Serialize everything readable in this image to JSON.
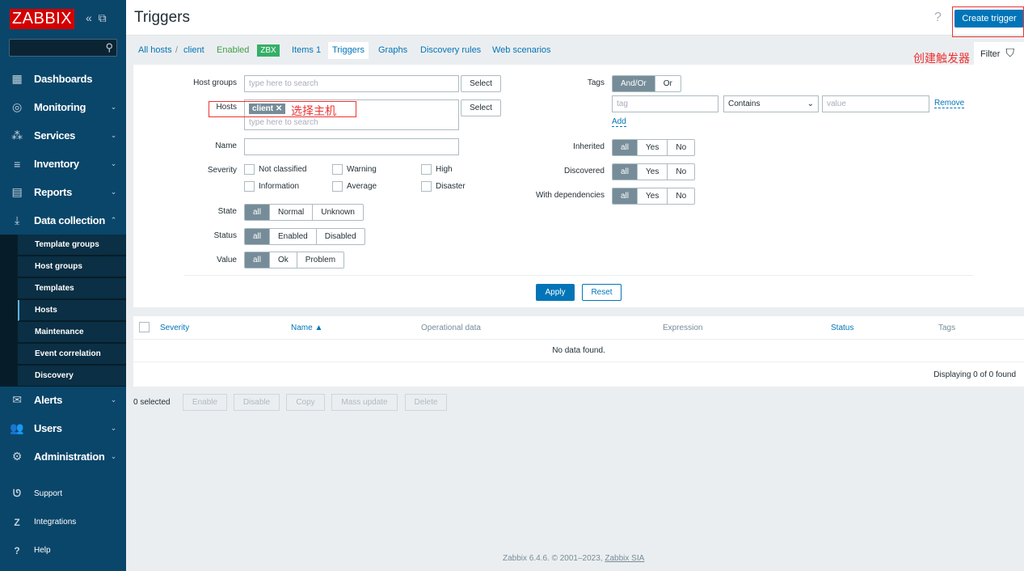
{
  "sidebar": {
    "logo": "ZABBIX",
    "search_icon": "search-icon",
    "menu": [
      {
        "label": "Dashboards",
        "icon": "▦"
      },
      {
        "label": "Monitoring",
        "icon": "◎"
      },
      {
        "label": "Services",
        "icon": "⁂"
      },
      {
        "label": "Inventory",
        "icon": "≡"
      },
      {
        "label": "Reports",
        "icon": "▤"
      },
      {
        "label": "Data collection",
        "icon": "⤓"
      }
    ],
    "submenu": [
      "Template groups",
      "Host groups",
      "Templates",
      "Hosts",
      "Maintenance",
      "Event correlation",
      "Discovery"
    ],
    "menu2": [
      {
        "label": "Alerts",
        "icon": "✉"
      },
      {
        "label": "Users",
        "icon": "👥"
      },
      {
        "label": "Administration",
        "icon": "⚙"
      }
    ],
    "bottom": [
      {
        "label": "Support",
        "icon": "ᘎ"
      },
      {
        "label": "Integrations",
        "icon": "Z"
      },
      {
        "label": "Help",
        "icon": "?"
      }
    ]
  },
  "header": {
    "title": "Triggers",
    "help": "?",
    "create_label": "Create trigger",
    "annotation_create": "创建触发器"
  },
  "nav": {
    "all_hosts": "All hosts",
    "sep": "/",
    "host": "client",
    "enabled": "Enabled",
    "zbx": "ZBX",
    "items": "Items 1",
    "triggers": "Triggers",
    "graphs": "Graphs",
    "discovery": "Discovery rules",
    "web": "Web scenarios",
    "filter": "Filter"
  },
  "filter": {
    "host_groups_label": "Host groups",
    "placeholder": "type here to search",
    "select": "Select",
    "hosts_label": "Hosts",
    "host_tag": "client",
    "annotation_hosts": "选择主机",
    "name_label": "Name",
    "severity_label": "Severity",
    "severities": [
      "Not classified",
      "Warning",
      "High",
      "Information",
      "Average",
      "Disaster"
    ],
    "state_label": "State",
    "state": [
      "all",
      "Normal",
      "Unknown"
    ],
    "status_label": "Status",
    "status": [
      "all",
      "Enabled",
      "Disabled"
    ],
    "value_label": "Value",
    "value": [
      "all",
      "Ok",
      "Problem"
    ],
    "tags_label": "Tags",
    "tags_mode": [
      "And/Or",
      "Or"
    ],
    "tag_placeholder": "tag",
    "operator": "Contains",
    "value_placeholder": "value",
    "remove": "Remove",
    "add": "Add",
    "inherited_label": "Inherited",
    "discovered_label": "Discovered",
    "deps_label": "With dependencies",
    "yn": [
      "all",
      "Yes",
      "No"
    ],
    "apply": "Apply",
    "reset": "Reset"
  },
  "table": {
    "columns": [
      "Severity",
      "Name ▲",
      "Operational data",
      "Expression",
      "Status",
      "Tags"
    ],
    "empty": "No data found.",
    "summary": "Displaying 0 of 0 found"
  },
  "actions": {
    "selected": "0 selected",
    "buttons": [
      "Enable",
      "Disable",
      "Copy",
      "Mass update",
      "Delete"
    ]
  },
  "footer": {
    "text": "Zabbix 6.4.6. © 2001–2023, ",
    "link": "Zabbix SIA"
  }
}
